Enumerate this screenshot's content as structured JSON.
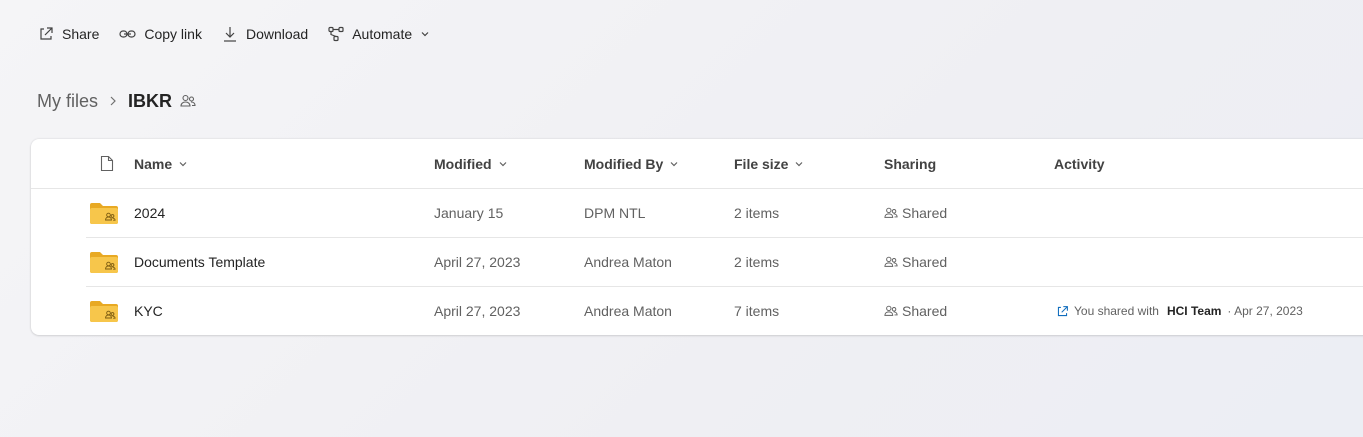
{
  "toolbar": {
    "share_label": "Share",
    "copy_link_label": "Copy link",
    "download_label": "Download",
    "automate_label": "Automate"
  },
  "breadcrumb": {
    "root": "My files",
    "current": "IBKR"
  },
  "table": {
    "columns": {
      "name": "Name",
      "modified": "Modified",
      "modified_by": "Modified By",
      "file_size": "File size",
      "sharing": "Sharing",
      "activity": "Activity"
    },
    "rows": [
      {
        "name": "2024",
        "modified": "January 15",
        "modified_by": "DPM NTL",
        "file_size": "2 items",
        "sharing": "Shared"
      },
      {
        "name": "Documents Template",
        "modified": "April 27, 2023",
        "modified_by": "Andrea Maton",
        "file_size": "2 items",
        "sharing": "Shared"
      },
      {
        "name": "KYC",
        "modified": "April 27, 2023",
        "modified_by": "Andrea Maton",
        "file_size": "7 items",
        "sharing": "Shared",
        "activity": {
          "prefix": "You shared with",
          "target": "HCI Team",
          "date": "· Apr 27, 2023"
        }
      }
    ]
  },
  "colors": {
    "folder": "#f7c64b",
    "folder_dark": "#e8a923",
    "accent": "#0f6cbd"
  },
  "icons": [
    "share-icon",
    "link-icon",
    "download-icon",
    "automate-icon",
    "chevron-down-icon",
    "chevron-right-icon",
    "people-icon",
    "file-type-icon",
    "folder-shared-icon"
  ]
}
